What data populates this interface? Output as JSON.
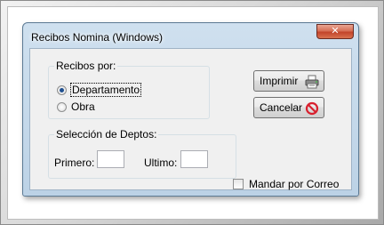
{
  "window": {
    "title": "Recibos Nomina (Windows)",
    "close_glyph": "✕"
  },
  "recibos_group": {
    "legend": "Recibos por:",
    "options": [
      {
        "label": "Departamento",
        "selected": true
      },
      {
        "label": "Obra",
        "selected": false
      }
    ]
  },
  "deptos_group": {
    "legend": "Selección de Deptos:",
    "primero_label": "Primero:",
    "primero_value": "",
    "ultimo_label": "Ultimo:",
    "ultimo_value": ""
  },
  "buttons": {
    "print_label": "Imprimir",
    "print_icon": "printer-icon",
    "cancel_label": "Cancelar",
    "cancel_icon": "no-entry-icon"
  },
  "mail": {
    "label": "Mandar por Correo",
    "checked": false
  }
}
